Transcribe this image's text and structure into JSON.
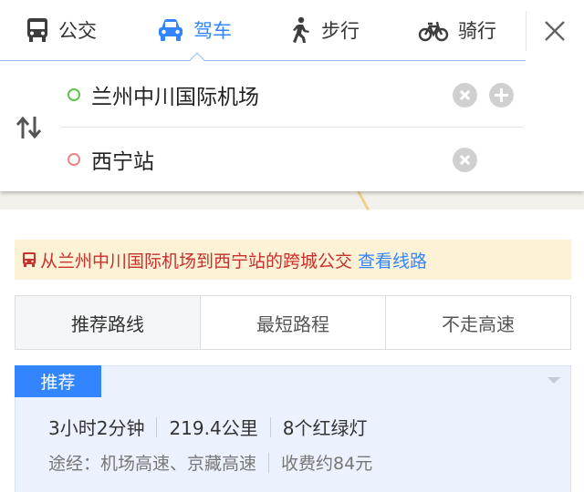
{
  "tabs": [
    {
      "label": "公交",
      "icon": "bus-icon",
      "active": false
    },
    {
      "label": "驾车",
      "icon": "car-icon",
      "active": true
    },
    {
      "label": "步行",
      "icon": "walk-icon",
      "active": false
    },
    {
      "label": "骑行",
      "icon": "bike-icon",
      "active": false
    }
  ],
  "search": {
    "start": "兰州中川国际机场",
    "end": "西宁站"
  },
  "notice": {
    "text": "从兰州中川国际机场到西宁站的跨城公交",
    "link": "查看线路"
  },
  "route_options": [
    "推荐路线",
    "最短路程",
    "不走高速"
  ],
  "route": {
    "badge": "推荐",
    "duration": "3小时2分钟",
    "distance": "219.4公里",
    "lights": "8个红绿灯",
    "via": "途经：机场高速、京藏高速",
    "toll": "收费约84元"
  },
  "colors": {
    "accent": "#3385ff",
    "notice_bg": "#fdf2d6",
    "notice_text": "#c8302c",
    "card_bg": "#ebf2fd",
    "start_dot": "#5cc34b",
    "end_dot": "#f08484"
  }
}
